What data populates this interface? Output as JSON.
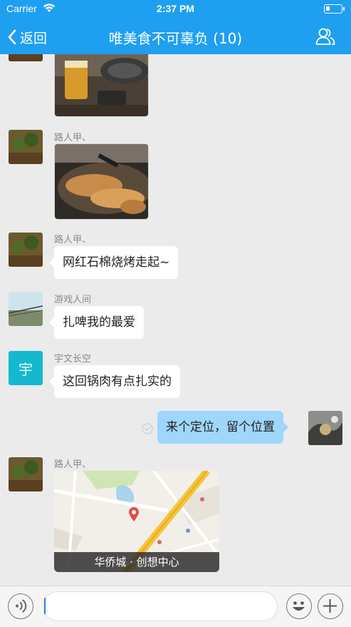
{
  "status_bar": {
    "carrier": "Carrier",
    "time": "2:37 PM"
  },
  "nav": {
    "back_label": "返回",
    "title": "唯美食不可辜负 (10)"
  },
  "messages": {
    "m1": {
      "sender": "路人甲、"
    },
    "m2": {
      "sender": "路人甲、",
      "text": "网红石棉烧烤走起~"
    },
    "m3": {
      "sender": "游戏人间",
      "text": "扎啤我的最爱"
    },
    "m4": {
      "sender": "宇文长空",
      "avatar_text": "宇",
      "text": "这回锅肉有点扎实的"
    },
    "m5": {
      "text": "来个定位，留个位置"
    },
    "m6": {
      "sender": "路人甲、",
      "location": "华侨城 · 创想中心"
    }
  },
  "input": {
    "value": "",
    "placeholder": ""
  },
  "colors": {
    "brand": "#1f9ff0",
    "own_bubble": "#9fd6fb",
    "text_avatar": "#14b9cf"
  },
  "icons": [
    "wifi-icon",
    "battery-icon",
    "back-chevron-icon",
    "members-icon",
    "voice-icon",
    "emoji-icon",
    "plus-icon",
    "map-pin-icon",
    "read-check-icon"
  ]
}
